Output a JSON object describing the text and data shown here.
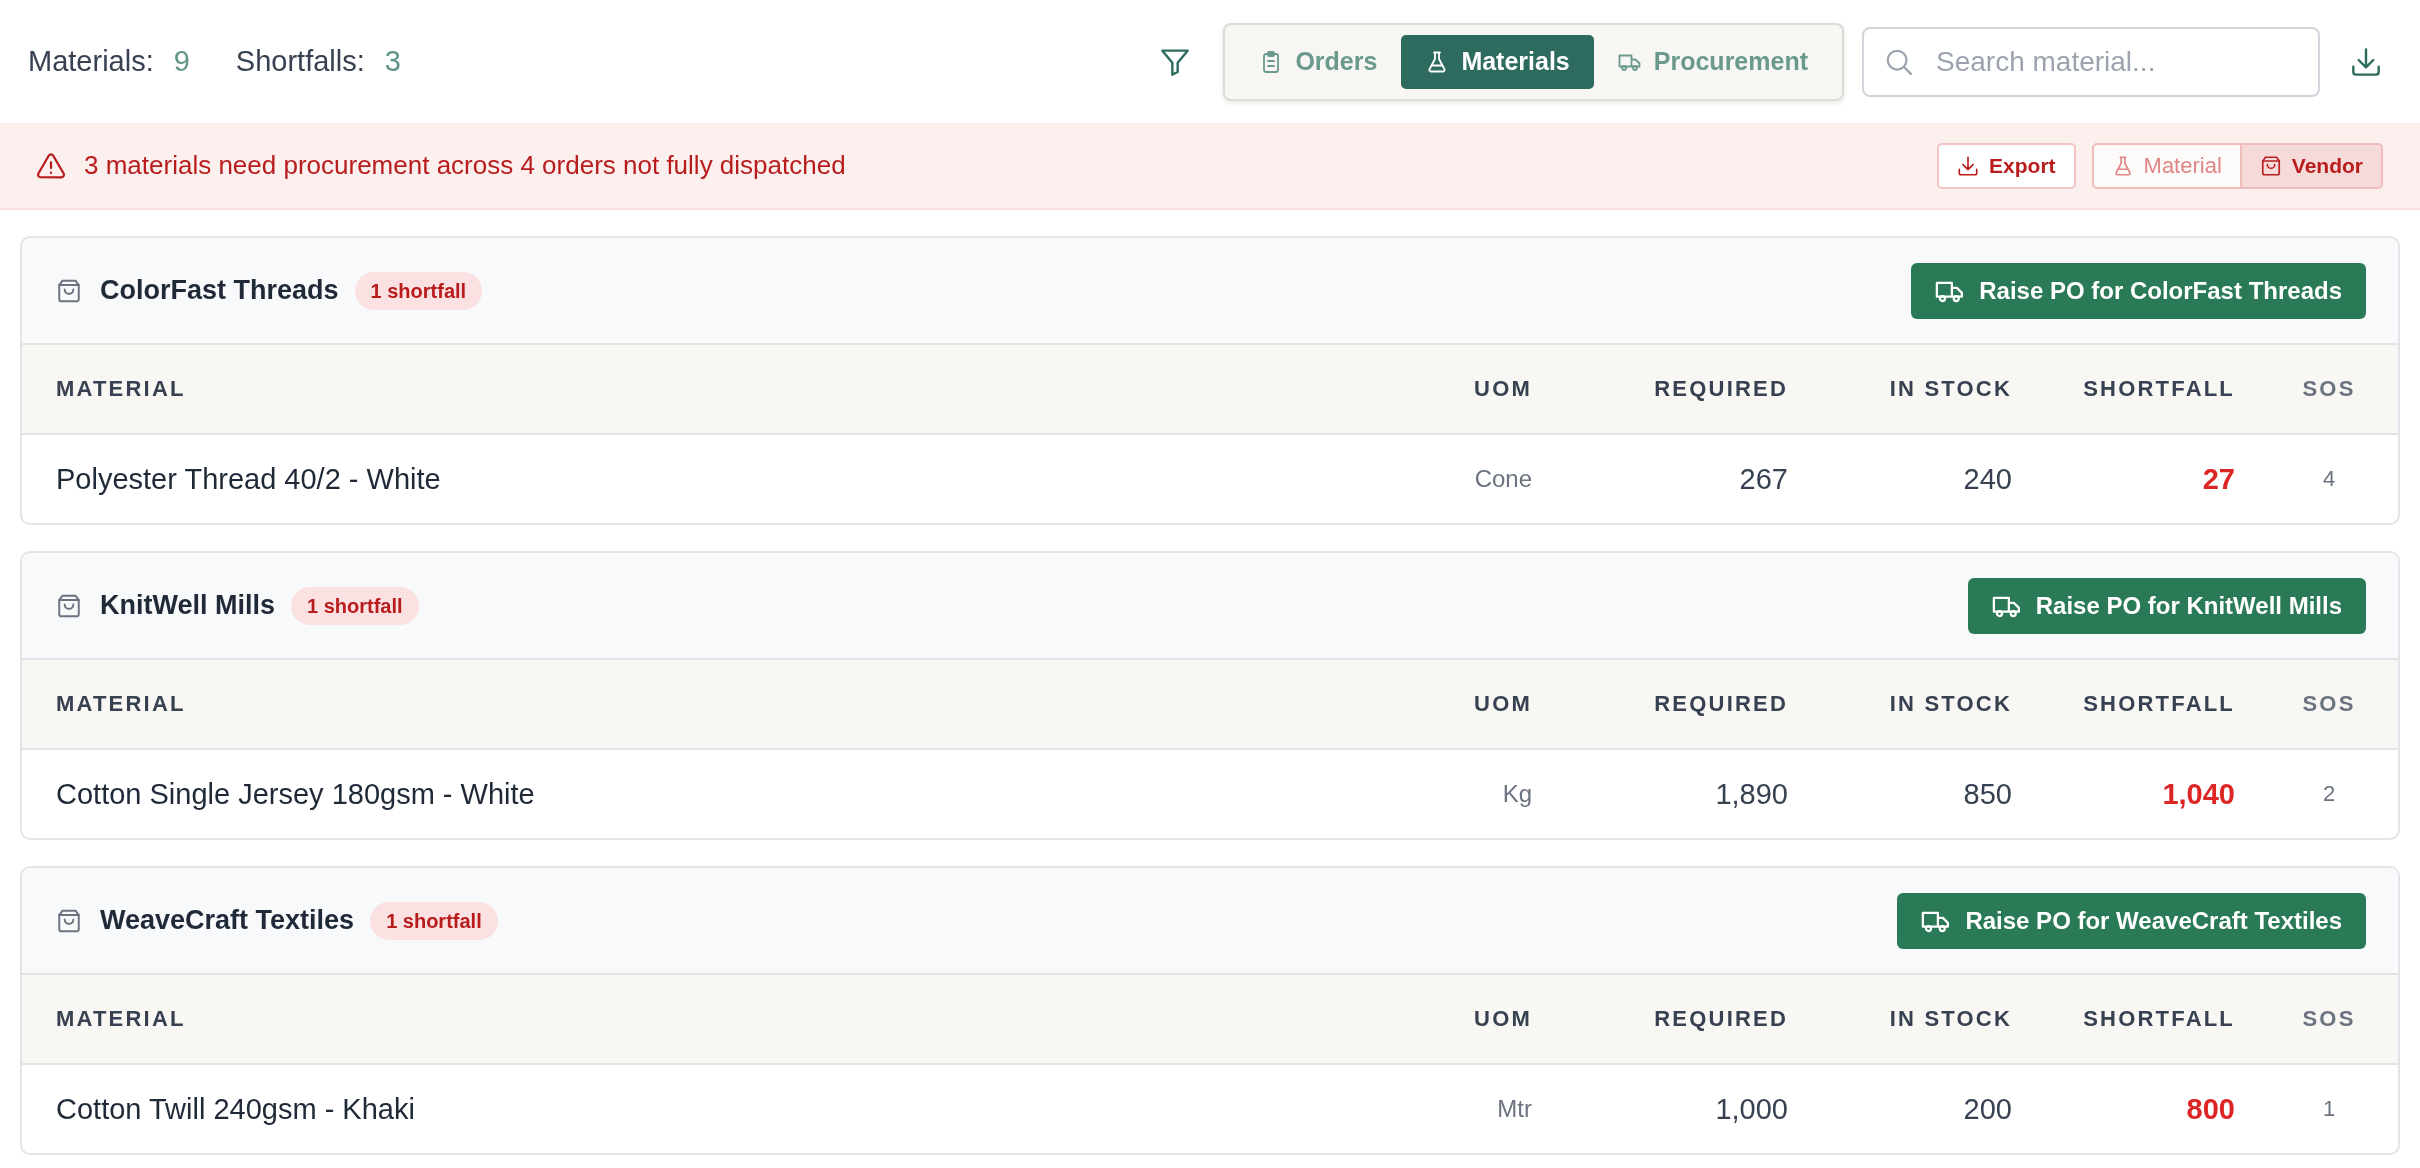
{
  "summary": [
    {
      "label": "Materials:",
      "value": "9"
    },
    {
      "label": "Shortfalls:",
      "value": "3"
    }
  ],
  "view_tabs": [
    {
      "label": "Orders",
      "selected": false
    },
    {
      "label": "Materials",
      "selected": true
    },
    {
      "label": "Procurement",
      "selected": false
    }
  ],
  "search": {
    "placeholder": "Search material..."
  },
  "alert": {
    "message": "3 materials need procurement across 4 orders not fully dispatched",
    "export_label": "Export",
    "group_by": [
      {
        "label": "Material",
        "selected": false
      },
      {
        "label": "Vendor",
        "selected": true
      }
    ]
  },
  "vendor_groups": [
    {
      "name": "ColorFast Threads",
      "badge": "1 shortfall",
      "action": "Raise PO for ColorFast Threads",
      "columns": [
        "MATERIAL",
        "UOM",
        "REQUIRED",
        "IN STOCK",
        "SHORTFALL",
        "SOS"
      ],
      "rows": [
        {
          "cells": [
            "Polyester Thread 40/2 - White",
            "Cone",
            "267",
            "240",
            "27",
            "4"
          ]
        }
      ]
    },
    {
      "name": "KnitWell Mills",
      "badge": "1 shortfall",
      "action": "Raise PO for KnitWell Mills",
      "columns": [
        "MATERIAL",
        "UOM",
        "REQUIRED",
        "IN STOCK",
        "SHORTFALL",
        "SOS"
      ],
      "rows": [
        {
          "cells": [
            "Cotton Single Jersey 180gsm - White",
            "Kg",
            "1,890",
            "850",
            "1,040",
            "2"
          ]
        }
      ]
    },
    {
      "name": "WeaveCraft Textiles",
      "badge": "1 shortfall",
      "action": "Raise PO for WeaveCraft Textiles",
      "columns": [
        "MATERIAL",
        "UOM",
        "REQUIRED",
        "IN STOCK",
        "SHORTFALL",
        "SOS"
      ],
      "rows": [
        {
          "cells": [
            "Cotton Twill 240gsm - Khaki",
            "Mtr",
            "1,000",
            "200",
            "800",
            "1"
          ]
        }
      ]
    }
  ]
}
